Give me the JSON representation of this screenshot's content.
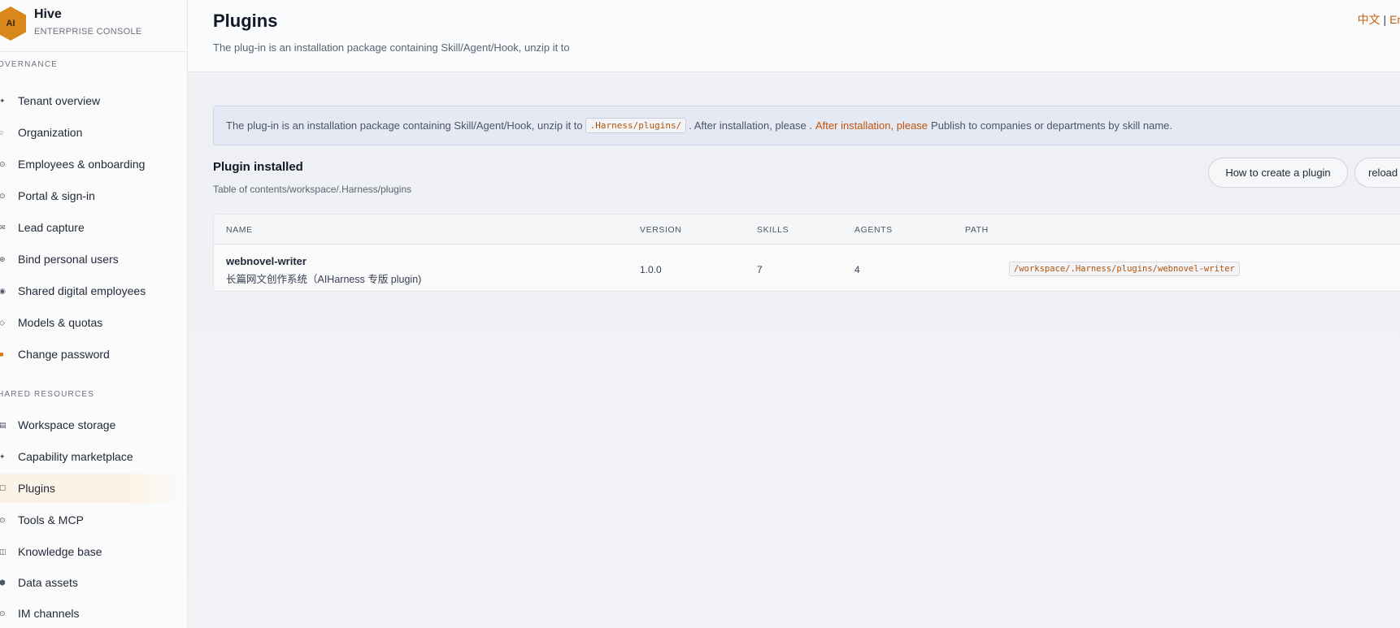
{
  "brand": {
    "logo_text": "AI",
    "name": "Hive",
    "subtitle": "ENTERPRISE CONSOLE",
    "logo_color": "#d9861a"
  },
  "sidebar": {
    "sections": [
      {
        "label": "OVERNANCE",
        "items": [
          {
            "label": "Tenant overview",
            "icon": "sparkle-icon",
            "glyph": "✦"
          },
          {
            "label": "Organization",
            "icon": "circle-icon",
            "glyph": "○"
          },
          {
            "label": "Employees & onboarding",
            "icon": "dot-ring-icon",
            "glyph": "⊙"
          },
          {
            "label": "Portal & sign-in",
            "icon": "target-icon",
            "glyph": "⊙"
          },
          {
            "label": "Lead capture",
            "icon": "mail-icon",
            "glyph": "✉"
          },
          {
            "label": "Bind personal users",
            "icon": "plus-circle-icon",
            "glyph": "⊕"
          },
          {
            "label": "Shared digital employees",
            "icon": "record-icon",
            "glyph": "◉"
          },
          {
            "label": "Models & quotas",
            "icon": "diamond-icon",
            "glyph": "◇"
          },
          {
            "label": "Change password",
            "icon": "lock-icon",
            "glyph": "🔒"
          }
        ]
      },
      {
        "label": "HARED RESOURCES",
        "items": [
          {
            "label": "Workspace storage",
            "icon": "storage-icon",
            "glyph": "▤"
          },
          {
            "label": "Capability marketplace",
            "icon": "sparkle-icon",
            "glyph": "✦"
          },
          {
            "label": "Plugins",
            "icon": "square-icon",
            "glyph": "☐",
            "active": true
          },
          {
            "label": "Tools & MCP",
            "icon": "target-icon",
            "glyph": "⊙"
          },
          {
            "label": "Knowledge base",
            "icon": "book-icon",
            "glyph": "◫"
          },
          {
            "label": "Data assets",
            "icon": "hexagon-icon",
            "glyph": "⬢"
          },
          {
            "label": "IM channels",
            "icon": "dot-ring-icon",
            "glyph": "⊙"
          }
        ]
      }
    ]
  },
  "header": {
    "title": "Plugins",
    "subtitle": "The plug-in is an installation package containing Skill/Agent/Hook, unzip it to",
    "lang_zh": "中文",
    "lang_sep": "|",
    "lang_en": "Eng"
  },
  "notice": {
    "text_before": "The plug-in is an installation package containing Skill/Agent/Hook, unzip it to",
    "code": ".Harness/plugins/",
    "text_mid": ". After installation, please .",
    "highlight": "After installation, please",
    "text_after": "Publish to companies or departments by skill name."
  },
  "plugins_section": {
    "title": "Plugin installed",
    "subtitle": "Table of contents/workspace/.Harness/plugins",
    "how_to_button": "How to create a plugin",
    "reload_button": "reload"
  },
  "table": {
    "columns": [
      "NAME",
      "VERSION",
      "SKILLS",
      "AGENTS",
      "PATH"
    ],
    "rows": [
      {
        "name": "webnovel-writer",
        "description": "长篇网文创作系统（AIHarness 专版 plugin)",
        "version": "1.0.0",
        "skills": "7",
        "agents": "4",
        "path": "/workspace/.Harness/plugins/webnovel-writer"
      }
    ]
  },
  "colors": {
    "accent": "#c2620e",
    "active_nav_bg": "#fbf3e6",
    "code_text": "#b45309"
  }
}
